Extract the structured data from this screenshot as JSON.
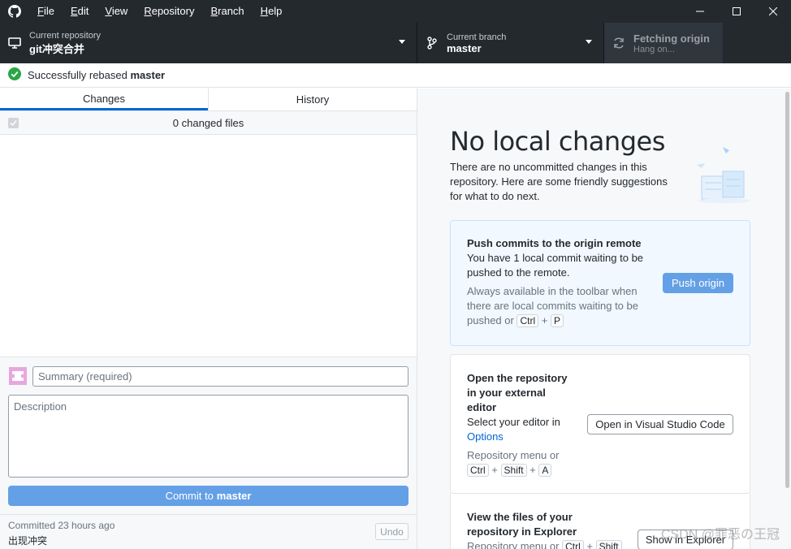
{
  "titlebar": {
    "menu": [
      {
        "accel": "F",
        "rest": "ile"
      },
      {
        "accel": "E",
        "rest": "dit"
      },
      {
        "accel": "V",
        "rest": "iew"
      },
      {
        "accel": "R",
        "rest": "epository"
      },
      {
        "accel": "B",
        "rest": "ranch"
      },
      {
        "accel": "H",
        "rest": "elp"
      }
    ]
  },
  "toolbar": {
    "repo_label": "Current repository",
    "repo_value": "git冲突合并",
    "branch_label": "Current branch",
    "branch_value": "master",
    "fetch_label": "Fetching origin",
    "fetch_value": "Hang on..."
  },
  "banner": {
    "prefix": "Successfully rebased",
    "branch": "master"
  },
  "left": {
    "tabs": [
      "Changes",
      "History"
    ],
    "changed_files": "0 changed files",
    "summary_placeholder": "Summary (required)",
    "description_placeholder": "Description",
    "commit_prefix": "Commit to",
    "commit_branch": "master",
    "last_commit_time": "Committed 23 hours ago",
    "last_commit_message": "出现冲突",
    "undo_label": "Undo"
  },
  "right": {
    "title": "No local changes",
    "subtitle": "There are no uncommitted changes in this repository. Here are some friendly suggestions for what to do next.",
    "push": {
      "title": "Push commits to the origin remote",
      "text": "You have 1 local commit waiting to be pushed to the remote.",
      "hint_prefix": "Always available in the toolbar when there are local commits waiting to be pushed or",
      "key1": "Ctrl",
      "plus": "+",
      "key2": "P",
      "button": "Push origin"
    },
    "editor": {
      "title": "Open the repository in your external editor",
      "text": "Select your editor in",
      "link": "Options",
      "hint": "Repository menu or",
      "key1": "Ctrl",
      "key2": "Shift",
      "key3": "A",
      "plus": "+",
      "button": "Open in Visual Studio Code"
    },
    "explorer": {
      "title": "View the files of your repository in Explorer",
      "hint": "Repository menu or",
      "key1": "Ctrl",
      "key2": "Shift",
      "plus": "+",
      "button": "Show in Explorer"
    }
  },
  "watermark": "CSDN @罪恶の王冠",
  "colors": {
    "titlebar": "#24292e",
    "accent": "#0366d6",
    "primary_button": "#64a0e6",
    "success": "#28a745",
    "push_card_bg": "#f1f8ff"
  }
}
